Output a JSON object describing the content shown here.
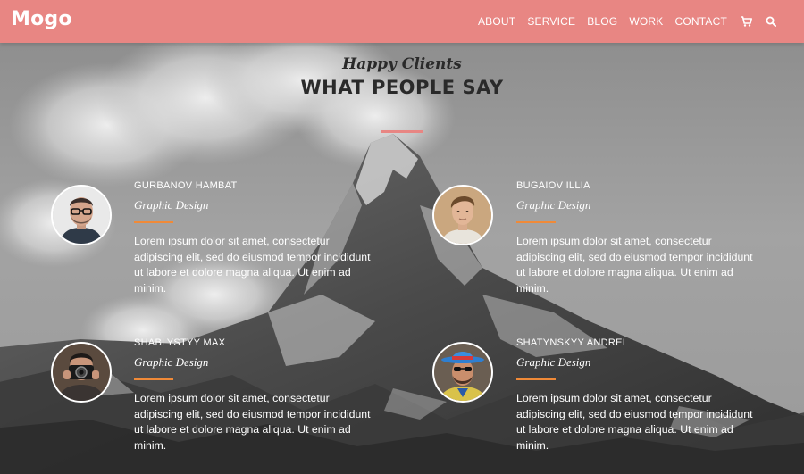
{
  "brand": {
    "logo": "Mogo"
  },
  "nav": {
    "items": [
      {
        "label": "ABOUT"
      },
      {
        "label": "SERVICE"
      },
      {
        "label": "BLOG"
      },
      {
        "label": "WORK"
      },
      {
        "label": "CONTACT"
      }
    ],
    "icons": [
      "cart-icon",
      "search-icon"
    ]
  },
  "section": {
    "subtitle": "Happy Clients",
    "title": "WHAT PEOPLE SAY"
  },
  "colors": {
    "header": "#e88683",
    "accent_line": "#f08a38",
    "title_line": "#e88683"
  },
  "testimonials": [
    {
      "name": "GURBANOV HAMBAT",
      "role": "Graphic Design",
      "text": "Lorem ipsum dolor sit amet, consectetur adipiscing elit, sed do eiusmod tempor incididunt ut labore et dolore magna aliqua. Ut enim ad minim.",
      "avatar": "man-glasses"
    },
    {
      "name": "BUGAIOV ILLIA",
      "role": "Graphic Design",
      "text": "Lorem ipsum dolor sit amet, consectetur adipiscing elit, sed do eiusmod tempor incididunt ut labore et dolore magna aliqua. Ut enim ad minim.",
      "avatar": "young-man"
    },
    {
      "name": "SHABLYSTYY MAX",
      "role": "Graphic Design",
      "text": "Lorem ipsum dolor sit amet, consectetur adipiscing elit, sed do eiusmod tempor incididunt ut labore et dolore magna aliqua. Ut enim ad minim.",
      "avatar": "man-camera"
    },
    {
      "name": "SHATYNSKYY ANDREI",
      "role": "Graphic Design",
      "text": "Lorem ipsum dolor sit amet, consectetur adipiscing elit, sed do eiusmod tempor incididunt ut labore et dolore magna aliqua. Ut enim ad minim.",
      "avatar": "man-hat"
    }
  ]
}
